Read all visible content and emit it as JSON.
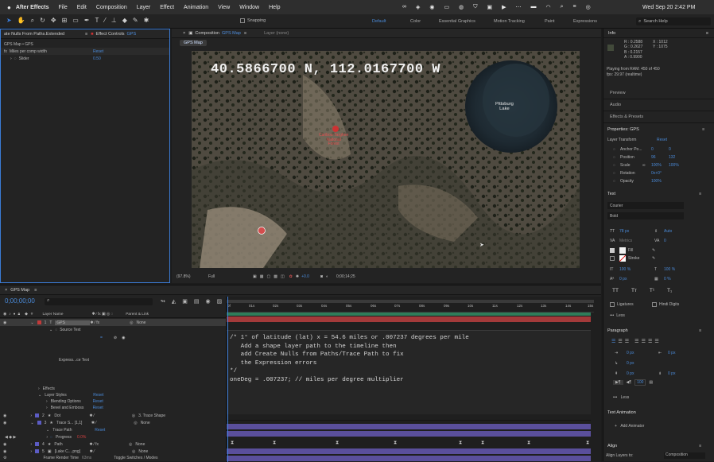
{
  "menubar": {
    "app": "After Effects",
    "items": [
      "File",
      "Edit",
      "Composition",
      "Layer",
      "Effect",
      "Animation",
      "View",
      "Window",
      "Help"
    ],
    "clock": "Wed Sep 20  2:42 PM"
  },
  "toolbar": {
    "snapping": "Snapping",
    "workspaces": [
      "Default",
      "Color",
      "Essential Graphics",
      "Motion Tracking",
      "Paint",
      "Expressions"
    ],
    "search_placeholder": "Search Help"
  },
  "effect_controls": {
    "left_tab": "ate Nulls From Paths.Extended",
    "tab": "Effect Controls",
    "tab_layer": "GPS",
    "breadcrumb": "GPS Map • GPS",
    "effect_name": "Miles per comp width",
    "reset": "Reset",
    "param": "Slider",
    "param_value": "0.50"
  },
  "composition": {
    "tab": "Composition",
    "tab_name": "GPS Map",
    "layer_tab": "Layer (none)",
    "subtab": "GPS Map",
    "overlay_coords": "40.5866700 N, 112.0167700 W",
    "lake_label": "Pittsburg\nLake",
    "marker_label": "Caribou-Targhee\nNational\nForest",
    "zoom": "(97.8%)",
    "resolution": "Full",
    "exposure": "+0.0",
    "timecode": "0;00;14;25"
  },
  "info": {
    "title": "Info",
    "r": "R : 0.2588",
    "g": "G : 0.2627",
    "b": "B : 0.2157",
    "a": "A : 0.9900",
    "x": "X : 1012",
    "y": "Y : 1075",
    "ram": "Playing from RAM: 450 of 450",
    "fps": "fps: 29.97 (realtime)"
  },
  "side_panels": [
    "Preview",
    "Audio",
    "Effects & Presets"
  ],
  "properties": {
    "title": "Properties: GPS",
    "layer_transform": "Layer Transform",
    "reset": "Reset",
    "rows": [
      {
        "label": "Anchor Po...",
        "v1": "0",
        "v2": "0"
      },
      {
        "label": "Position",
        "v1": "96",
        "v2": "132"
      },
      {
        "label": "Scale",
        "v1": "100%",
        "v2": "100%"
      },
      {
        "label": "Rotation",
        "v1": "0x+0°",
        "v2": ""
      },
      {
        "label": "Opacity",
        "v1": "100%",
        "v2": ""
      }
    ]
  },
  "text_panel": {
    "title": "Text",
    "font": "Courier",
    "style": "Bold",
    "size": "78 px",
    "leading": "Auto",
    "kerning": "Metrics",
    "tracking": "0",
    "fill": "Fill",
    "stroke": "Stroke",
    "v_scale": "100 %",
    "h_scale": "100 %",
    "baseline": "0 px",
    "tsume": "0 %",
    "caps": [
      "TT",
      "Tт",
      "T¹",
      "T₁"
    ],
    "ligatures": "Ligatures",
    "hindi": "Hindi Digits",
    "less": "Less"
  },
  "paragraph": {
    "title": "Paragraph",
    "v": [
      "0 px",
      "0 px",
      "0 px",
      "0 px",
      "0 px"
    ],
    "hyphen": "100",
    "less": "Less"
  },
  "text_animation": {
    "title": "Text Animation",
    "add": "Add Animator"
  },
  "align": {
    "title": "Align",
    "label": "Align Layers to:",
    "value": "Composition"
  },
  "timeline": {
    "tab": "GPS Map",
    "timecode": "0;00;00;00",
    "search_placeholder": "",
    "col_layer": "Layer Name",
    "col_parent": "Parent & Link",
    "ruler": [
      "0f",
      "01s",
      "02s",
      "03s",
      "04s",
      "05s",
      "06s",
      "07s",
      "08s",
      "09s",
      "10s",
      "11s",
      "12s",
      "13s",
      "14s",
      "15s"
    ],
    "layers": [
      {
        "num": "1",
        "name": "GPS",
        "parent": "None",
        "color": "#c23a3a"
      },
      {
        "num": "2",
        "name": "Dot",
        "parent": "3. Trace Shape",
        "color": "#5c5cc4"
      },
      {
        "num": "3",
        "name": "Trace S... [1,1]",
        "parent": "None",
        "color": "#5c5cc4"
      },
      {
        "num": "4",
        "name": "Path",
        "parent": "None",
        "color": "#5c5cc4"
      },
      {
        "num": "5",
        "name": "[Lake C....png]",
        "parent": "None",
        "color": "#5c5cc4"
      }
    ],
    "source_text": "Source Text",
    "expression_text": "Express...ce Text",
    "effects": "Effects",
    "layer_styles": "Layer Styles",
    "blending": "Blending Options",
    "bevel": "Bevel and Emboss",
    "trace_path": "Trace Path",
    "progress": "Progress",
    "progress_value": "0.0%",
    "reset": "Reset",
    "footer_left": "Frame Render Time",
    "footer_ms": "63ms",
    "footer_right": "Toggle Switches / Modes"
  },
  "expression": {
    "lines": [
      "/* 1° of latitude (lat) x = 54.6 miles or .007237 degrees per mile",
      "   Add a shape layer path to the timeline then",
      "   add Create Nulls from Paths/Trace Path to fix",
      "   the Expression errors",
      "*/",
      "oneDeg = .007237; // miles per degree multiplier"
    ]
  },
  "colors": {
    "accent": "#3a7bd5",
    "timeline_red": "#a33a3a",
    "timeline_purple": "#5a4f9c",
    "timeline_green": "#2f7d5a"
  }
}
